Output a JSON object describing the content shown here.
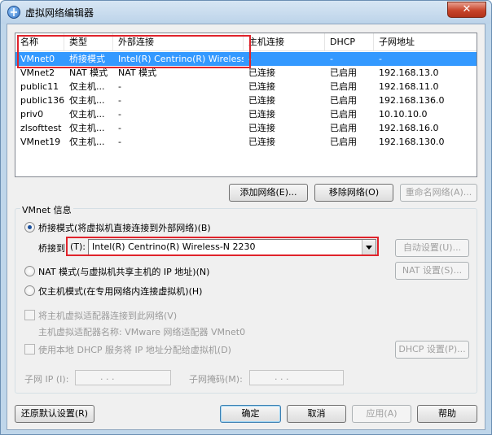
{
  "window": {
    "title": "虚拟网络编辑器",
    "close": "✕"
  },
  "table": {
    "headers": [
      "名称",
      "类型",
      "外部连接",
      "主机连接",
      "DHCP",
      "子网地址"
    ],
    "rows": [
      {
        "name": "VMnet0",
        "type": "桥接模式",
        "external": "Intel(R) Centrino(R) Wireless...",
        "host": "-",
        "dhcp": "-",
        "subnet": "-"
      },
      {
        "name": "VMnet2",
        "type": "NAT 模式",
        "external": "NAT 模式",
        "host": "已连接",
        "dhcp": "已启用",
        "subnet": "192.168.13.0"
      },
      {
        "name": "public11",
        "type": "仅主机...",
        "external": "-",
        "host": "已连接",
        "dhcp": "已启用",
        "subnet": "192.168.11.0"
      },
      {
        "name": "public136",
        "type": "仅主机...",
        "external": "-",
        "host": "已连接",
        "dhcp": "已启用",
        "subnet": "192.168.136.0"
      },
      {
        "name": "priv0",
        "type": "仅主机...",
        "external": "-",
        "host": "已连接",
        "dhcp": "已启用",
        "subnet": "10.10.10.0"
      },
      {
        "name": "zlsofttest",
        "type": "仅主机...",
        "external": "-",
        "host": "已连接",
        "dhcp": "已启用",
        "subnet": "192.168.16.0"
      },
      {
        "name": "VMnet19",
        "type": "仅主机...",
        "external": "-",
        "host": "已连接",
        "dhcp": "已启用",
        "subnet": "192.168.130.0"
      }
    ]
  },
  "list_buttons": {
    "add": "添加网络(E)...",
    "remove": "移除网络(O)",
    "rename": "重命名网络(A)..."
  },
  "vmnet_info": {
    "group_title": "VMnet 信息",
    "bridged_label": "桥接模式(将虚拟机直接连接到外部网络)(B)",
    "bridged_to_label": "桥接到",
    "bridged_to_accel": "(T):",
    "bridged_adapter": "Intel(R) Centrino(R) Wireless-N 2230",
    "auto_button": "自动设置(U)...",
    "nat_label": "NAT 模式(与虚拟机共享主机的 IP 地址)(N)",
    "nat_button": "NAT 设置(S)...",
    "hostonly_label": "仅主机模式(在专用网络内连接虚拟机)(H)",
    "connect_adapter_label": "将主机虚拟适配器连接到此网络(V)",
    "adapter_name_label": "主机虚拟适配器名称: VMware 网络适配器 VMnet0",
    "dhcp_label": "使用本地 DHCP 服务将 IP 地址分配给虚拟机(D)",
    "dhcp_button": "DHCP 设置(P)...",
    "subnet_ip_label": "子网 IP (I):",
    "subnet_mask_label": "子网掩码(M):",
    "ip_dots": ". . ."
  },
  "footer": {
    "restore": "还原默认设置(R)",
    "ok": "确定",
    "cancel": "取消",
    "apply": "应用(A)",
    "help": "帮助"
  },
  "colors": {
    "selection": "#3399ff",
    "highlight_box": "#e0232b",
    "frame": "#bfd6ea"
  },
  "icons": {
    "title": "network-globe-icon",
    "close": "close-icon",
    "dropdown": "chevron-down-icon"
  }
}
